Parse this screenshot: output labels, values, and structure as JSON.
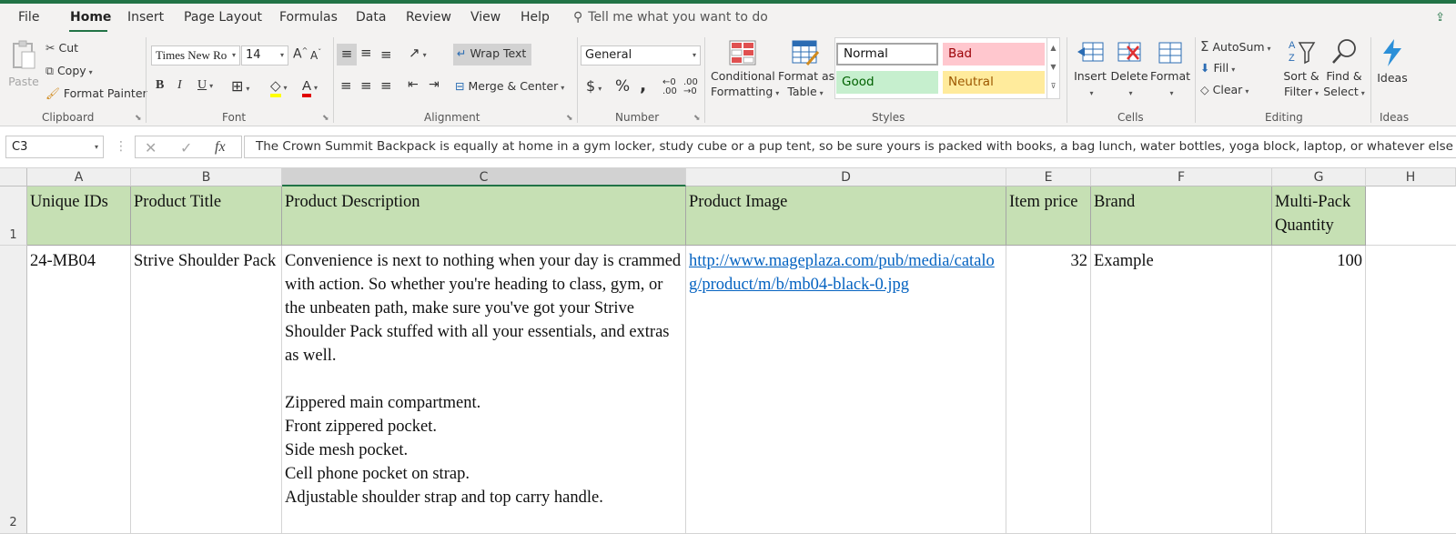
{
  "menu_tabs": [
    "File",
    "Home",
    "Insert",
    "Page Layout",
    "Formulas",
    "Data",
    "Review",
    "View",
    "Help"
  ],
  "active_tab": "Home",
  "tell_me": "Tell me what you want to do",
  "clipboard": {
    "paste": "Paste",
    "cut": "Cut",
    "copy": "Copy",
    "format_painter": "Format Painter",
    "label": "Clipboard"
  },
  "font": {
    "name": "Times New Ro",
    "size": "14",
    "bold": "B",
    "italic": "I",
    "underline": "U",
    "label": "Font",
    "grow": "A",
    "shrink": "A"
  },
  "alignment": {
    "wrap_text": "Wrap Text",
    "merge_center": "Merge & Center",
    "label": "Alignment"
  },
  "number": {
    "format": "General",
    "currency": "$",
    "percent": "%",
    "comma": ",",
    "label": "Number"
  },
  "styles": {
    "conditional": "Conditional",
    "formatting": "Formatting",
    "format_as": "Format as",
    "table": "Table",
    "normal": "Normal",
    "bad": "Bad",
    "good": "Good",
    "neutral": "Neutral",
    "label": "Styles"
  },
  "cells": {
    "insert": "Insert",
    "delete": "Delete",
    "format": "Format",
    "label": "Cells"
  },
  "editing": {
    "autosum": "AutoSum",
    "fill": "Fill",
    "clear": "Clear",
    "sort_filter_1": "Sort &",
    "sort_filter_2": "Filter",
    "find_select_1": "Find &",
    "find_select_2": "Select",
    "label": "Editing"
  },
  "ideas": {
    "ideas": "Ideas",
    "label": "Ideas"
  },
  "name_box": "C3",
  "formula_bar": "The Crown Summit Backpack is equally at home in a gym locker, study cube or a pup tent, so be sure yours is packed with books, a bag lunch, water bottles, yoga block, laptop, or whatever else you want in",
  "columns": [
    "A",
    "B",
    "C",
    "D",
    "E",
    "F",
    "G",
    "H"
  ],
  "rows": [
    "1",
    "2"
  ],
  "header_row": [
    "Unique IDs",
    "Product Title",
    "Product Description",
    "Product Image",
    "Item price",
    "Brand",
    "Multi-Pack Quantity"
  ],
  "data_row": {
    "id": "24-MB04",
    "title": "Strive Shoulder Pack",
    "description_intro": "Convenience is next to nothing when your day is crammed with action. So whether you're heading to class, gym, or the unbeaten path, make sure you've got your Strive Shoulder Pack stuffed with all your essentials, and extras as well.",
    "description_lines": [
      "Zippered main compartment.",
      "Front zippered pocket.",
      "Side mesh pocket.",
      "Cell phone pocket on strap.",
      "Adjustable shoulder strap and top carry handle."
    ],
    "image_url": "http://www.mageplaza.com/pub/media/catalog/product/m/b/mb04-black-0.jpg",
    "price": "32",
    "brand": "Example",
    "quantity": "100"
  },
  "colors": {
    "accent": "#217346",
    "header_fill": "#c6e0b4",
    "bad_fill": "#ffc7ce",
    "good_fill": "#c6efce",
    "neutral_fill": "#ffeb9c",
    "link": "#0563c1"
  }
}
